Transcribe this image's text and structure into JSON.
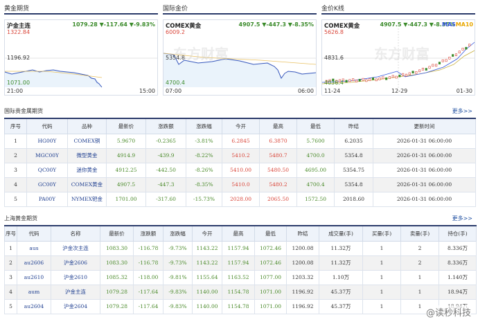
{
  "sections": {
    "futures": "黄金期货",
    "intl": "国际金价",
    "kline": "金价K线",
    "intl_table": "国际贵金属期货",
    "sh_table": "上海黄金期货",
    "more": "更多>>"
  },
  "watermark": "东方财富",
  "panels": [
    {
      "name": "沪金主连",
      "value": "1079.28 ▼-117.64 ▼-9.83%",
      "top": "1322.84",
      "mid": "1196.92",
      "bottom": "1071.00",
      "x_start": "21:00",
      "x_end": "15:00"
    },
    {
      "name": "COMEX黄金",
      "value": "4907.5 ▼-447.3 ▼-8.35%",
      "top": "6009.2",
      "mid": "5354.8",
      "bottom": "4700.4",
      "x_start": "07:00",
      "x_end": "06:00"
    },
    {
      "name": "COMEX黄金",
      "value": "4907.5 ▼-447.3 ▼-8.35%",
      "ma5": "MA5",
      "ma10": "MA10",
      "top": "5626.8",
      "mid": "4831.6",
      "bottom": "4036.4",
      "x_start": "11-24",
      "x_mid": "12-29",
      "x_end": "01-30"
    }
  ],
  "intl_table": {
    "headers": [
      "序号",
      "代码",
      "品种",
      "最新价",
      "涨跌额",
      "涨跌幅",
      "今开",
      "最高",
      "最低",
      "昨结",
      "更新时间"
    ],
    "rows": [
      [
        "1",
        "HG00Y",
        "COMEX铜",
        "5.9670",
        "-0.2365",
        "-3.81%",
        "6.2845",
        "6.3870",
        "5.7600",
        "6.2035",
        "2026-01-31 06:00:00"
      ],
      [
        "2",
        "MGC00Y",
        "微型黄金",
        "4914.9",
        "-439.9",
        "-8.22%",
        "5410.2",
        "5480.7",
        "4700.0",
        "5354.8",
        "2026-01-31 06:00:00"
      ],
      [
        "3",
        "QC00Y",
        "迷你黄金",
        "4912.25",
        "-442.50",
        "-8.26%",
        "5410.00",
        "5480.50",
        "4695.00",
        "5354.75",
        "2026-01-31 06:00:00"
      ],
      [
        "4",
        "GC00Y",
        "COMEX黄金",
        "4907.5",
        "-447.3",
        "-8.35%",
        "5410.0",
        "5480.2",
        "4700.4",
        "5354.8",
        "2026-01-31 06:00:00"
      ],
      [
        "5",
        "PA00Y",
        "NYMEX钯金",
        "1701.00",
        "-317.60",
        "-15.73%",
        "2028.00",
        "2065.50",
        "1572.50",
        "2018.60",
        "2026-01-31 06:00:00"
      ]
    ]
  },
  "sh_table": {
    "headers": [
      "序号",
      "代码",
      "名称",
      "最新价",
      "涨跌额",
      "涨跌幅",
      "今开",
      "最高",
      "最低",
      "昨结",
      "成交量(手)",
      "买量(手)",
      "卖量(手)",
      "持仓(手)"
    ],
    "rows": [
      [
        "1",
        "aus",
        "沪金次主连",
        "1083.30",
        "-116.78",
        "-9.73%",
        "1143.22",
        "1157.94",
        "1072.46",
        "1200.08",
        "11.32万",
        "1",
        "2",
        "8.336万"
      ],
      [
        "2",
        "au2606",
        "沪金2606",
        "1083.30",
        "-116.78",
        "-9.73%",
        "1143.22",
        "1157.94",
        "1072.46",
        "1200.08",
        "11.32万",
        "1",
        "2",
        "8.336万"
      ],
      [
        "3",
        "au2610",
        "沪金2610",
        "1085.32",
        "-118.00",
        "-9.81%",
        "1155.64",
        "1163.52",
        "1077.00",
        "1203.32",
        "1.10万",
        "1",
        "1",
        "1.140万"
      ],
      [
        "4",
        "aum",
        "沪金主连",
        "1079.28",
        "-117.64",
        "-9.83%",
        "1140.00",
        "1154.78",
        "1071.00",
        "1196.92",
        "45.37万",
        "1",
        "1",
        "18.94万"
      ],
      [
        "5",
        "au2604",
        "沪金2604",
        "1079.28",
        "-117.64",
        "-9.83%",
        "1140.00",
        "1154.78",
        "1071.00",
        "1196.92",
        "45.37万",
        "1",
        "1",
        "18.94万"
      ]
    ]
  },
  "weibo": "@读秒科技",
  "colors": {
    "up": "#d9463a",
    "down": "#3a8a2a",
    "accent": "#2a3a6a"
  }
}
